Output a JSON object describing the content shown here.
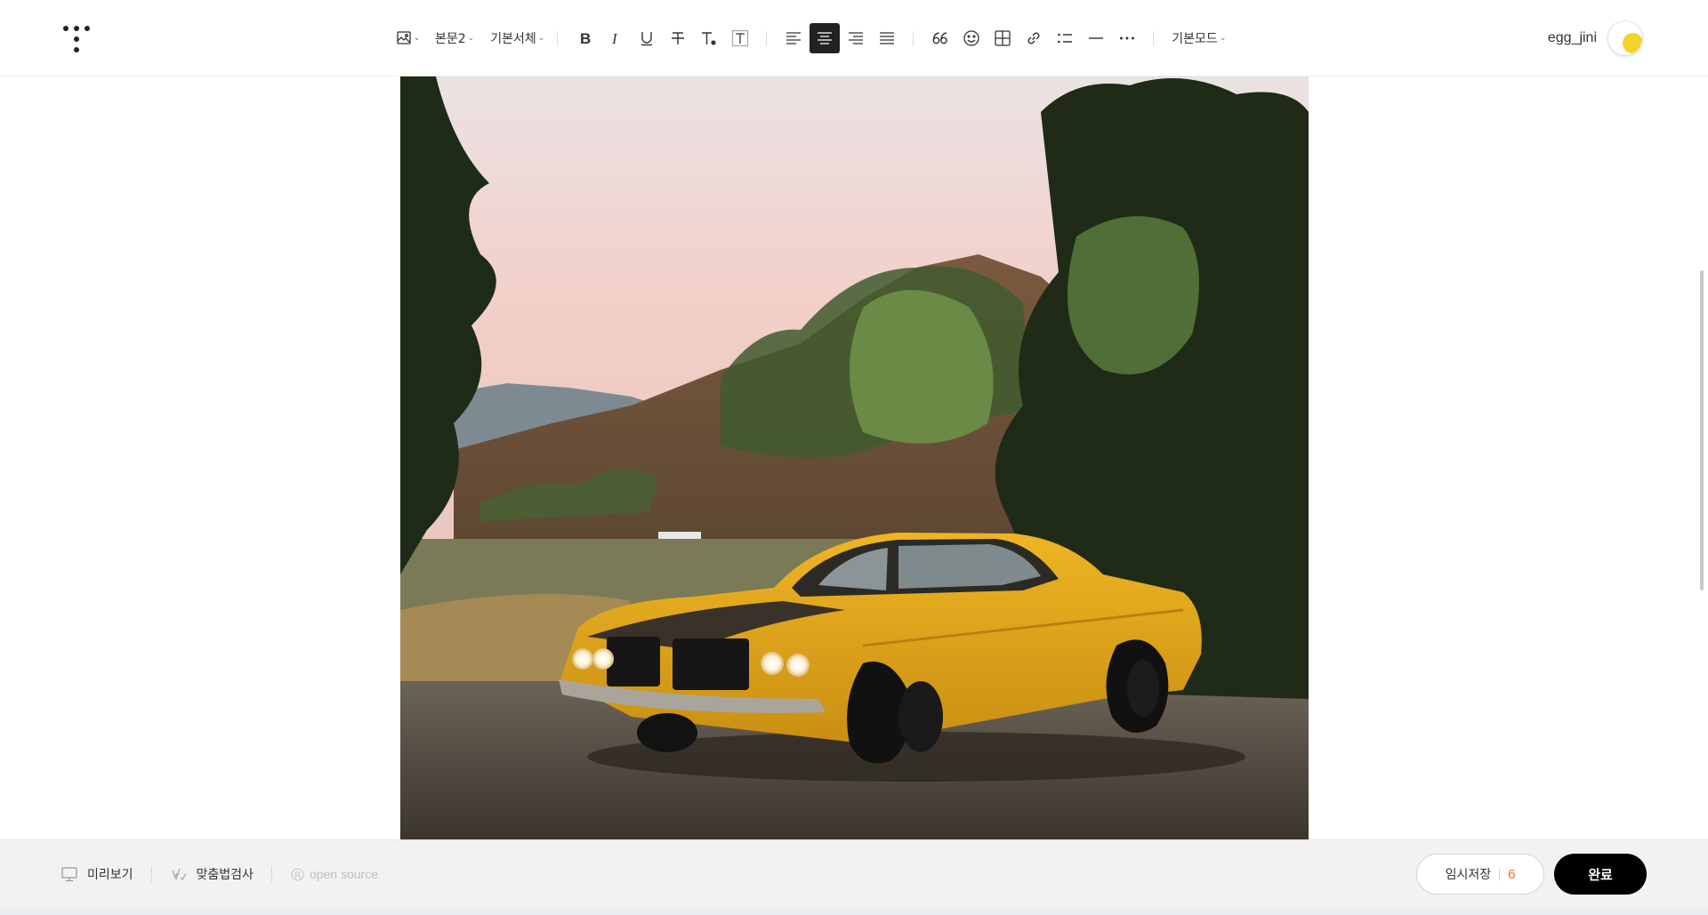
{
  "toolbar": {
    "paragraph_style": "본문2",
    "font_family": "기본서체",
    "mode": "기본모드",
    "align_active": "center"
  },
  "user": {
    "name": "egg_jini",
    "avatar_color": "#f3d428"
  },
  "bottom": {
    "preview_label": "미리보기",
    "spellcheck_label": "맞춤법검사",
    "opensource_label": "open source",
    "save_label": "임시저장",
    "save_count": "6",
    "done_label": "완료"
  },
  "colors": {
    "active_tool": "#222222",
    "save_count": "#f26a2a",
    "done_button": "#000000"
  }
}
